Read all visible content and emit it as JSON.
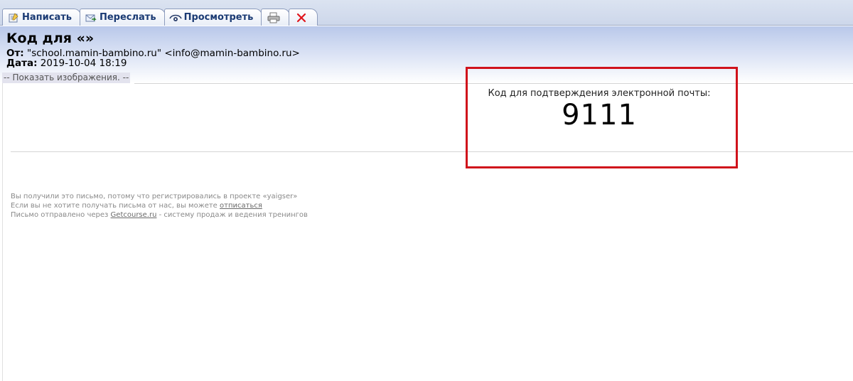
{
  "toolbar": {
    "compose_label": "Написать",
    "forward_label": "Переслать",
    "view_label": "Просмотреть",
    "delete_color": "#e0151b"
  },
  "message": {
    "subject": "Код для «»",
    "from_label": "От:",
    "from_value": "\"school.mamin-bambino.ru\" <info@mamin-bambino.ru>",
    "date_label": "Дата:",
    "date_value": "2019-10-04 18:19",
    "show_images": "-- Показать изображения. --"
  },
  "body": {
    "code_label": "Код для подтверждения электронной почты:",
    "code_value": "9111",
    "highlight_color": "#d0121b"
  },
  "footer": {
    "line1": "Вы получили это письмо, потому что регистрировались в проекте «yaigser»",
    "line2_prefix": "Если вы не хотите получать письма от нас, вы можете ",
    "line2_link": "отписаться",
    "line3_prefix": "Письмо отправлено через ",
    "line3_link": "Getcourse.ru",
    "line3_suffix": " - систему продаж и ведения тренингов"
  }
}
